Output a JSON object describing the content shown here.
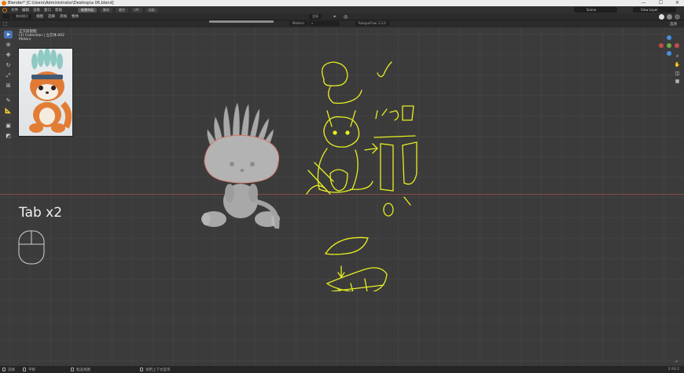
{
  "titlebar": {
    "title": "Blender* [C:\\Users\\Administrator\\Desktop\\a 06.blend]",
    "minimize": "—",
    "maximize": "☐",
    "close": "✕"
  },
  "menu": [
    "文件",
    "编辑",
    "渲染",
    "窗口",
    "帮助"
  ],
  "workspaces": [
    "新建布局",
    "雕刻",
    "着色",
    "UV",
    "动画"
  ],
  "header_right": {
    "scene": "Scene",
    "view_layer": "View Layer"
  },
  "viewport_header": {
    "mode": "物体模式",
    "items": [
      "视图",
      "选择",
      "添加",
      "物体"
    ],
    "transform": "全局",
    "overlay_label": "Modern",
    "addon": "RetopoFlow 3.3.0",
    "options": "选项"
  },
  "info": {
    "view": "正交前视图",
    "collection": "(1) Collection | 立方体.002",
    "units": "Meters"
  },
  "overlay_text": "Tab x2",
  "statusbar": {
    "select": "选择",
    "pan": "平移",
    "box": "框选视图",
    "menu": "调用上下文菜单",
    "version": "2.93.2"
  },
  "colors": {
    "accent": "#4772b3",
    "sketch": "#e8ef21",
    "axis_red": "#c94a4a",
    "model": "#b0b0b0"
  }
}
